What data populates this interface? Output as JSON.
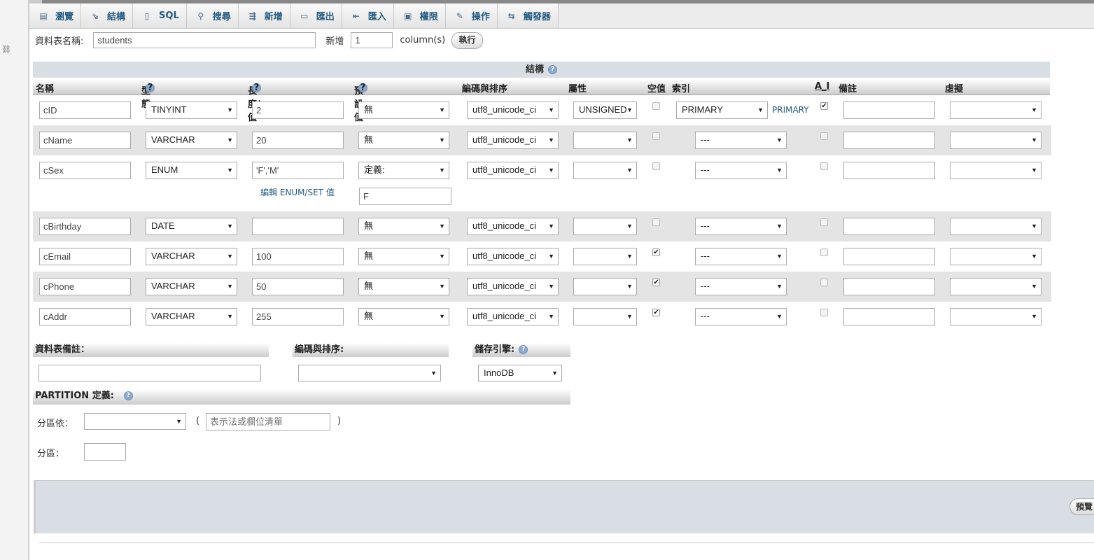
{
  "tabs": [
    {
      "label": "瀏覽",
      "icon": "browse-icon",
      "glyph": "▤"
    },
    {
      "label": "結構",
      "icon": "structure-icon",
      "glyph": "⇘"
    },
    {
      "label": "SQL",
      "icon": "sql-icon",
      "glyph": "▯"
    },
    {
      "label": "搜尋",
      "icon": "search-icon",
      "glyph": "⚲"
    },
    {
      "label": "新增",
      "icon": "insert-icon",
      "glyph": "⇶"
    },
    {
      "label": "匯出",
      "icon": "export-icon",
      "glyph": "▭"
    },
    {
      "label": "匯入",
      "icon": "import-icon",
      "glyph": "⇤"
    },
    {
      "label": "權限",
      "icon": "privileges-icon",
      "glyph": "▣"
    },
    {
      "label": "操作",
      "icon": "operations-icon",
      "glyph": "✎"
    },
    {
      "label": "觸發器",
      "icon": "triggers-icon",
      "glyph": "⇆"
    }
  ],
  "table_name": {
    "label": "資料表名稱:",
    "value": "students"
  },
  "add": {
    "label": "新增",
    "value": "1",
    "suffix": "column(s)",
    "go": "執行"
  },
  "structure_title": "結構",
  "columns": {
    "name": "名稱",
    "type": "型態",
    "length": "長度/值",
    "default": "預設值",
    "collation": "編碼與排序",
    "attributes": "屬性",
    "null": "空值",
    "index": "索引",
    "ai": "A_I",
    "comment": "備註",
    "virtual": "虛擬"
  },
  "fields": [
    {
      "name": "cID",
      "type": "TINYINT",
      "length": "2",
      "default": "無",
      "collation": "utf8_unicode_ci",
      "attribute": "UNSIGNED",
      "null": false,
      "index": "PRIMARY",
      "index_label": "PRIMARY",
      "ai": true,
      "comment": "",
      "virtual": ""
    },
    {
      "name": "cName",
      "type": "VARCHAR",
      "length": "20",
      "default": "無",
      "collation": "utf8_unicode_ci",
      "attribute": "",
      "null": false,
      "index": "---",
      "ai": false,
      "comment": "",
      "virtual": ""
    },
    {
      "name": "cSex",
      "type": "ENUM",
      "length": "'F','M'",
      "default": "定義:",
      "default_value": "F",
      "collation": "utf8_unicode_ci",
      "attribute": "",
      "null": false,
      "index": "---",
      "ai": false,
      "comment": "",
      "virtual": "",
      "enum_link": "編輯 ENUM/SET 值"
    },
    {
      "name": "cBirthday",
      "type": "DATE",
      "length": "",
      "default": "無",
      "collation": "utf8_unicode_ci",
      "attribute": "",
      "null": false,
      "index": "---",
      "ai": false,
      "comment": "",
      "virtual": ""
    },
    {
      "name": "cEmail",
      "type": "VARCHAR",
      "length": "100",
      "default": "無",
      "collation": "utf8_unicode_ci",
      "attribute": "",
      "null": true,
      "index": "---",
      "ai": false,
      "comment": "",
      "virtual": ""
    },
    {
      "name": "cPhone",
      "type": "VARCHAR",
      "length": "50",
      "default": "無",
      "collation": "utf8_unicode_ci",
      "attribute": "",
      "null": true,
      "index": "---",
      "ai": false,
      "comment": "",
      "virtual": ""
    },
    {
      "name": "cAddr",
      "type": "VARCHAR",
      "length": "255",
      "default": "無",
      "collation": "utf8_unicode_ci",
      "attribute": "",
      "null": true,
      "index": "---",
      "ai": false,
      "comment": "",
      "virtual": ""
    }
  ],
  "table_comment": {
    "label": "資料表備註：",
    "value": ""
  },
  "table_collation": {
    "label": "編碼與排序:",
    "value": ""
  },
  "engine": {
    "label": "儲存引擎:",
    "value": "InnoDB"
  },
  "partition": {
    "label": "PARTITION 定義:",
    "by_label": "分區依：",
    "by_value": "",
    "expr_placeholder": "表示法或欄位清單",
    "open_paren": "(",
    "close_paren": ")",
    "count_label": "分區：",
    "count_value": ""
  },
  "preview_label": "預覽"
}
